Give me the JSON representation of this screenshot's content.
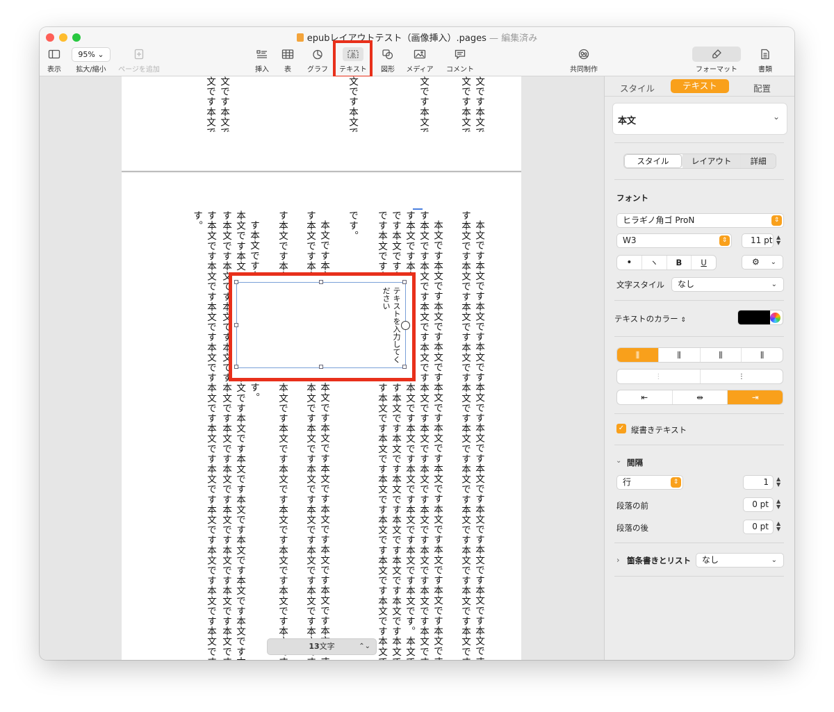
{
  "window": {
    "title": "epubレイアウトテスト（画像挿入）.pages",
    "title_sep": "—",
    "edited": "編集済み"
  },
  "toolbar": {
    "view_label": "表示",
    "zoom_value": "95%",
    "zoom_label": "拡大/縮小",
    "add_page_label": "ページを追加",
    "insert_label": "挿入",
    "table_label": "表",
    "chart_label": "グラフ",
    "text_label": "テキスト",
    "shape_label": "図形",
    "media_label": "メディア",
    "comment_label": "コメント",
    "collab_label": "共同制作",
    "format_label": "フォーマット",
    "document_label": "書類"
  },
  "document": {
    "page1_columns": [
      "文です本文で",
      "文です本文で",
      "文です本文で",
      "文です本文で",
      "文です本文で",
      "文です本文で"
    ],
    "page2_columns": [
      "本文です本文です本文です本文です本文です本文です本文です本文です本文です本文です本文です本文です",
      "す本文です本文です本文です本文です本文です本文です本文です本文です本文です本文です本文です本文です",
      "本文です本文です本文です本文です本文です本文です本文です本文です本文です本文です本文です本文です本文です",
      "す本文です本文です本文です本文です本文です本文です本文です本文です本文です本文です本文です本文です本文です",
      "す本文です本文です本文です本文です本文です本文です本文です本文です本文です本文です。本文です本文です本文です",
      "です本文です本文です本文です本文です本文です本文です本文です本文です本文です本文です本文です本文です",
      "です本文です本文です本文です本文です本文です本文です本文です本文です本文です本文です本文です本文です",
      "です。",
      "本文です本文です本文です本文です本文です本文です本文です本文です本文です本文です本文です本文です本",
      "す本文です本文です本文です本文です本文です本文です本文です本文です本文です本文です本文です本文です本",
      "す本文です本文です本文です本文です本文です本文です本文です本文です本文です本文です本文です本文です本",
      "す本文です本文です本文です本文です。",
      "本文です本文です本文です本文です本文です本文です本文です本文です本文です本文です本文です本文です",
      "す本文です本文です本文です本文です本文です本文です本文です本文です本文です本文です本文です本文です",
      "す本文です本文です本文です本文です本文です本文です本文です本文です本文です本文です本文です本文です",
      "す。"
    ],
    "textbox_placeholder": "テキストを入力してください",
    "word_count_num": "13",
    "word_count_unit": "文字"
  },
  "sidebar": {
    "tabs": [
      "スタイル",
      "テキスト",
      "配置"
    ],
    "paragraph_style": "本文",
    "subtabs": [
      "スタイル",
      "レイアウト",
      "詳細"
    ],
    "font_header": "フォント",
    "font_family": "ヒラギノ角ゴ ProN",
    "font_weight": "W3",
    "font_size": "11 pt",
    "bold": "B",
    "underline": "U",
    "char_style_label": "文字スタイル",
    "char_style_value": "なし",
    "text_color_label": "テキストのカラー",
    "text_color": "#000000",
    "vertical_text_label": "縦書きテキスト",
    "spacing_header": "間隔",
    "line_type": "行",
    "line_value": "1",
    "before_label": "段落の前",
    "before_value": "0 pt",
    "after_label": "段落の後",
    "after_value": "0 pt",
    "list_label": "箇条書きとリスト",
    "list_value": "なし"
  },
  "colors": {
    "accent": "#f9a01b",
    "highlight": "#e8301b",
    "selection": "#7aa0d8"
  }
}
